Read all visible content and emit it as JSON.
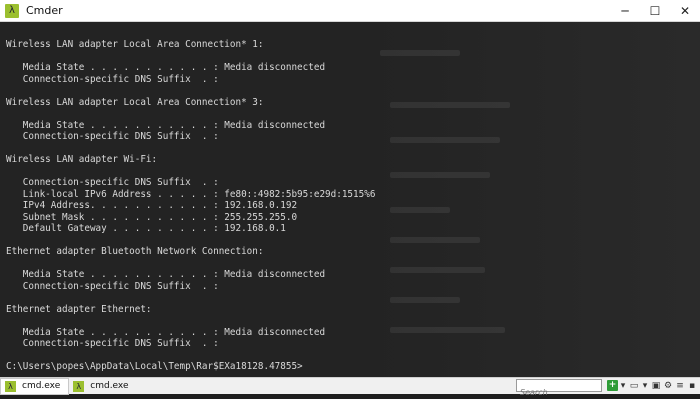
{
  "window": {
    "title": "Cmder",
    "icon_glyph": "λ",
    "controls": {
      "minimize": "─",
      "maximize": "☐",
      "close": "✕"
    }
  },
  "console": {
    "lines": [
      "Wireless LAN adapter Local Area Connection* 1:",
      "",
      "   Media State . . . . . . . . . . . : Media disconnected",
      "   Connection-specific DNS Suffix  . :",
      "",
      "Wireless LAN adapter Local Area Connection* 3:",
      "",
      "   Media State . . . . . . . . . . . : Media disconnected",
      "   Connection-specific DNS Suffix  . :",
      "",
      "Wireless LAN adapter Wi-Fi:",
      "",
      "   Connection-specific DNS Suffix  . :",
      "   Link-local IPv6 Address . . . . . : fe80::4982:5b95:e29d:1515%6",
      "   IPv4 Address. . . . . . . . . . . : 192.168.0.192",
      "   Subnet Mask . . . . . . . . . . . : 255.255.255.0",
      "   Default Gateway . . . . . . . . . : 192.168.0.1",
      "",
      "Ethernet adapter Bluetooth Network Connection:",
      "",
      "   Media State . . . . . . . . . . . : Media disconnected",
      "   Connection-specific DNS Suffix  . :",
      "",
      "Ethernet adapter Ethernet:",
      "",
      "   Media State . . . . . . . . . . . : Media disconnected",
      "   Connection-specific DNS Suffix  . :",
      "",
      "C:\\Users\\popes\\AppData\\Local\\Temp\\Rar$EXa18128.47855>"
    ]
  },
  "statusbar": {
    "tabs": [
      {
        "label": "cmd.exe",
        "icon_glyph": "λ"
      },
      {
        "label": "cmd.exe"
      }
    ],
    "search_placeholder": "Search",
    "icons": [
      "plus-icon",
      "dropdown-icon",
      "monitor-icon",
      "image-icon",
      "settings-icon",
      "menu-icon",
      "lock-icon"
    ]
  },
  "colors": {
    "terminal_bg": "#232323",
    "terminal_text": "#d9d9d9",
    "accent": "#9bbf2f"
  }
}
